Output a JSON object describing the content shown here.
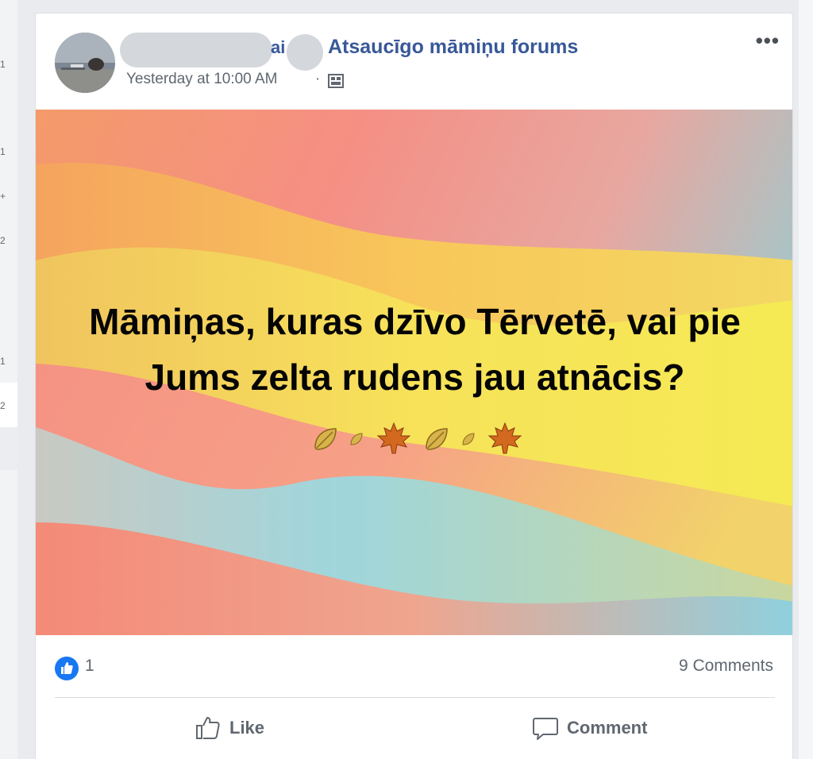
{
  "sidebar": {
    "counts": [
      "1",
      "1",
      "+",
      "2",
      "1",
      "2"
    ]
  },
  "post": {
    "author_fragment": "ai",
    "group_name": "Atsaucīgo māmiņu forums",
    "timestamp": "Yesterday at 10:00 AM",
    "separator": "·",
    "privacy_icon": "group-icon",
    "more_icon": "•••",
    "text": "Māmiņas, kuras dzīvo Tērvetē, vai pie Jums zelta rudens jau atnācis?",
    "emoji_icons": [
      "leaf-icon",
      "maple-leaf-icon",
      "leaf-icon",
      "maple-leaf-icon"
    ],
    "colors": {
      "link": "#385898",
      "like_blue": "#1877f2",
      "maple": "#d2691e"
    }
  },
  "footer": {
    "like_count": "1",
    "comment_count": "9 Comments",
    "like_label": "Like",
    "comment_label": "Comment"
  }
}
